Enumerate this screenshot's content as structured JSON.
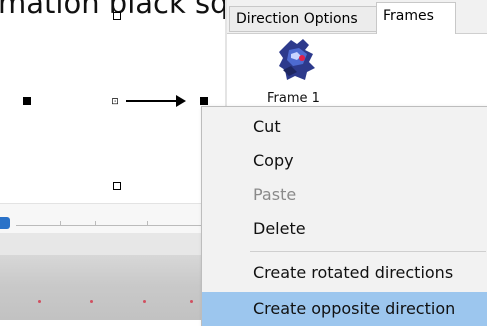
{
  "window": {
    "title_fragment": "mation black square"
  },
  "right_panel": {
    "tabs": [
      {
        "label": "Direction Options",
        "active": false
      },
      {
        "label": "Frames",
        "active": true
      }
    ],
    "frame_label": "Frame 1"
  },
  "context_menu": {
    "items": [
      {
        "label": "Cut",
        "enabled": true,
        "highlighted": false
      },
      {
        "label": "Copy",
        "enabled": true,
        "highlighted": false
      },
      {
        "label": "Paste",
        "enabled": false,
        "highlighted": false
      },
      {
        "label": "Delete",
        "enabled": true,
        "highlighted": false
      },
      {
        "label": "Create rotated directions",
        "enabled": true,
        "highlighted": false
      },
      {
        "label": "Create opposite direction",
        "enabled": true,
        "highlighted": true
      }
    ],
    "highlight_color": "#9cc6ee"
  },
  "canvas": {
    "hotspot_symbol": "⊡"
  },
  "colors": {
    "slider_accent": "#2a72c8",
    "frame_dot": "#d05060"
  },
  "icons": [
    "sprite-thumbnail-icon",
    "arrow-right-icon",
    "hotspot-icon"
  ]
}
